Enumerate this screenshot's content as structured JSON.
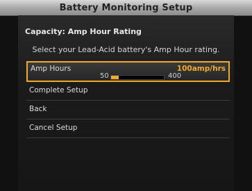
{
  "window": {
    "title": "Battery Monitoring Setup"
  },
  "heading": "Capacity: Amp Hour Rating",
  "description": "Select your Lead-Acid battery's Amp Hour rating.",
  "menu": {
    "amp_hours": {
      "label": "Amp Hours",
      "value": "100amp/hrs",
      "slider": {
        "min": "50",
        "max": "400",
        "level": 0.143
      }
    },
    "complete_setup": "Complete Setup",
    "back": "Back",
    "cancel_setup": "Cancel Setup"
  },
  "colors": {
    "accent": "#f0a92a"
  }
}
